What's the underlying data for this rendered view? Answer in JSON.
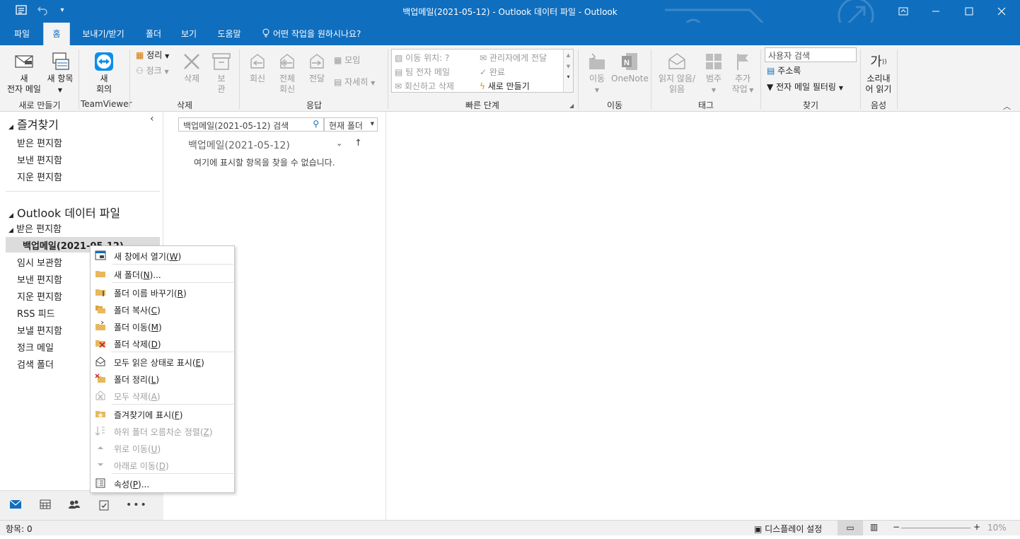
{
  "window": {
    "title": "백업메일(2021-05-12) - Outlook 데이터 파일  -  Outlook",
    "controls": [
      "restore-ribbon",
      "minimize",
      "maximize",
      "close"
    ]
  },
  "menu": {
    "tabs": [
      "파일",
      "홈",
      "보내기/받기",
      "폴더",
      "보기",
      "도움말"
    ],
    "active_tab": "홈",
    "tell_me": "어떤 작업을 원하시나요?"
  },
  "ribbon": {
    "new": {
      "group": "새로 만들기",
      "new_email": [
        "새",
        "전자 메일"
      ],
      "new_items": [
        "새 항목"
      ]
    },
    "teamviewer": {
      "group": "TeamViewer",
      "meeting": [
        "새",
        "회의"
      ]
    },
    "delete": {
      "group": "삭제",
      "cleanup": "정리",
      "junk": "정크",
      "delete": "삭제",
      "archive": [
        "보",
        "관"
      ]
    },
    "respond": {
      "group": "응답",
      "reply": "회신",
      "reply_all": [
        "전체",
        "회신"
      ],
      "forward": "전달",
      "meeting": "모임",
      "more": "자세히"
    },
    "quick_steps": {
      "group": "빠른 단계",
      "items": [
        "이동 위치: ?",
        "팀 전자 메일",
        "회신하고 삭제",
        "관리자에게 전달",
        "완료",
        "새로 만들기"
      ]
    },
    "move": {
      "group": "이동",
      "move": "이동",
      "onenote": "OneNote"
    },
    "tags": {
      "group": "태그",
      "unread_read": [
        "읽지 않음/",
        "읽음"
      ],
      "categorize": "범주",
      "followup": [
        "추가",
        "작업"
      ]
    },
    "find": {
      "group": "찾기",
      "search_people": "사용자 검색",
      "address_book": "주소록",
      "filter_email": "전자 메일 필터링"
    },
    "speech": {
      "group": "음성",
      "read_aloud": [
        "소리내",
        "어 읽기"
      ],
      "glyph": "가"
    }
  },
  "folder_pane": {
    "favorites_header": "즐겨찾기",
    "favorites": [
      "받은 편지함",
      "보낸 편지함",
      "지운 편지함"
    ],
    "datafile_header": "Outlook 데이터 파일",
    "inbox": "받은 편지함",
    "selected_folder": "백업메일(2021-05-12)",
    "folders": [
      "임시 보관함",
      "보낸 편지함",
      "지운 편지함",
      "RSS 피드",
      "보낼 편지함",
      "정크 메일",
      "검색 폴더"
    ]
  },
  "message_list": {
    "search_placeholder": "백업메일(2021-05-12) 검색",
    "scope": "현재 폴더",
    "folder_title": "백업메일(2021-05-12)",
    "empty_text": "여기에 표시할 항목을 찾을 수 없습니다."
  },
  "context_menu": {
    "items": [
      {
        "label": "새 창에서 열기",
        "key": "W",
        "icon": "new-window-icon",
        "enabled": true
      },
      {
        "label": "새 폴더",
        "key": "N",
        "suffix": "...",
        "icon": "folder-icon",
        "enabled": true
      },
      {
        "label": "폴더 이름 바꾸기",
        "key": "R",
        "icon": "rename-folder-icon",
        "enabled": true
      },
      {
        "label": "폴더 복사",
        "key": "C",
        "icon": "copy-folder-icon",
        "enabled": true
      },
      {
        "label": "폴더 이동",
        "key": "M",
        "icon": "move-folder-icon",
        "enabled": true
      },
      {
        "label": "폴더 삭제",
        "key": "D",
        "icon": "delete-folder-icon",
        "enabled": true
      },
      {
        "label": "모두 읽은 상태로 표시",
        "key": "E",
        "icon": "mark-read-icon",
        "enabled": true
      },
      {
        "label": "폴더 정리",
        "key": "L",
        "icon": "cleanup-folder-icon",
        "enabled": true
      },
      {
        "label": "모두 삭제",
        "key": "A",
        "icon": "delete-all-icon",
        "enabled": false
      },
      {
        "label": "즐겨찾기에 표시",
        "key": "F",
        "icon": "favorite-icon",
        "enabled": true
      },
      {
        "label": "하위 폴더 오름차순 정렬",
        "key": "Z",
        "icon": "sort-icon",
        "enabled": false
      },
      {
        "label": "위로 이동",
        "key": "U",
        "icon": "up-arrow-icon",
        "enabled": false
      },
      {
        "label": "아래로 이동",
        "key": "D",
        "icon": "down-arrow-icon",
        "enabled": false
      },
      {
        "label": "속성",
        "key": "P",
        "suffix": "...",
        "icon": "properties-icon",
        "enabled": true
      }
    ]
  },
  "status_bar": {
    "items_count": "항목: 0",
    "display_settings": "디스플레이 설정",
    "zoom": "10%"
  },
  "colors": {
    "brand": "#106ebe",
    "ribbon_bg": "#f3f3f3",
    "disabled": "#9a9a9a"
  }
}
